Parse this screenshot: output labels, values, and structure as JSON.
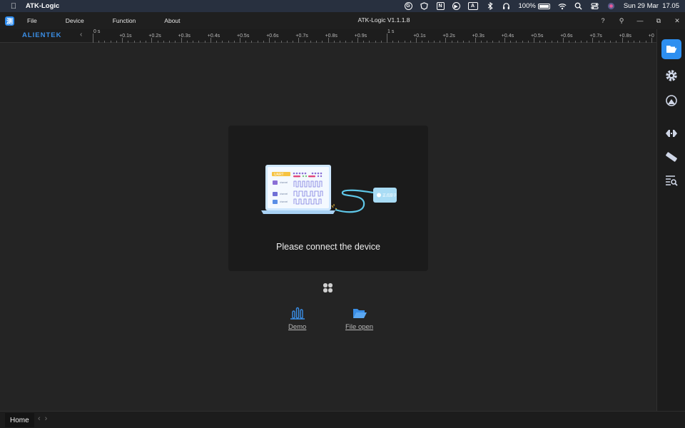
{
  "macos_menubar": {
    "app_name": "ATK-Logic",
    "battery_percent": "100%",
    "date_time": "Sun 29 Mar  17.05",
    "status_icons": [
      "grammarly-icon",
      "vpn-icon",
      "notion-icon",
      "play-icon",
      "input-source-icon",
      "bluetooth-icon",
      "headphones-icon",
      "battery-icon",
      "wifi-icon",
      "search-icon",
      "control-center-icon",
      "siri-icon"
    ],
    "input_source_letter": "A",
    "notion_letter": "N"
  },
  "titlebar": {
    "app_icon_glyph": "测",
    "menus": [
      "File",
      "Device",
      "Function",
      "About"
    ],
    "title": "ATK-Logic  V1.1.1.8",
    "controls": [
      "?",
      "⚲",
      "—",
      "⧉",
      "✕"
    ]
  },
  "toolbar": {
    "brand": "ALIENTEK",
    "collapse": "‹",
    "ruler_labels": [
      {
        "text": "0 s",
        "major": true
      },
      {
        "text": "+0.1s",
        "major": false
      },
      {
        "text": "+0.2s",
        "major": false
      },
      {
        "text": "+0.3s",
        "major": false
      },
      {
        "text": "+0.4s",
        "major": false
      },
      {
        "text": "+0.5s",
        "major": false
      },
      {
        "text": "+0.6s",
        "major": false
      },
      {
        "text": "+0.7s",
        "major": false
      },
      {
        "text": "+0.8s",
        "major": false
      },
      {
        "text": "+0.9s",
        "major": false
      },
      {
        "text": "1 s",
        "major": true
      },
      {
        "text": "+0.1s",
        "major": false
      },
      {
        "text": "+0.2s",
        "major": false
      },
      {
        "text": "+0.3s",
        "major": false
      },
      {
        "text": "+0.4s",
        "major": false
      },
      {
        "text": "+0.5s",
        "major": false
      },
      {
        "text": "+0.6s",
        "major": false
      },
      {
        "text": "+0.7s",
        "major": false
      },
      {
        "text": "+0.8s",
        "major": false
      },
      {
        "text": "+0",
        "major": false
      }
    ]
  },
  "main": {
    "connect_message": "Please connect the device",
    "illustration": {
      "uart_tag": "UART",
      "channel_text": "channel",
      "probe_label": "正点原子"
    },
    "quick_actions": [
      {
        "label": "Demo",
        "icon": "bar-chart-icon"
      },
      {
        "label": "File open",
        "icon": "folder-open-icon"
      }
    ]
  },
  "right_panel": {
    "buttons": [
      "folder-open-icon",
      "settings-icon",
      "measure-icon",
      "decoder-icon",
      "ruler-icon",
      "search-list-icon"
    ],
    "active_index": 0
  },
  "bottombar": {
    "home_tab": "Home",
    "back": "‹",
    "forward": "›"
  },
  "colors": {
    "accent": "#2e8ff0",
    "brand": "#3a8ee6",
    "background": "#242424",
    "card": "#1b1b1b"
  }
}
